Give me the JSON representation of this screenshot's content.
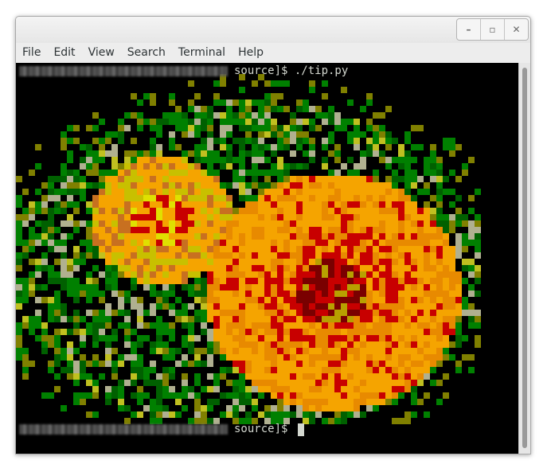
{
  "window": {
    "controls": {
      "minimize_icon": "minimize-icon",
      "maximize_icon": "maximize-icon",
      "close_icon": "close-icon",
      "minimize_glyph": "–",
      "maximize_glyph": "▫",
      "close_glyph": "✕"
    }
  },
  "menubar": {
    "items": [
      {
        "label": "File"
      },
      {
        "label": "Edit"
      },
      {
        "label": "View"
      },
      {
        "label": "Search"
      },
      {
        "label": "Terminal"
      },
      {
        "label": "Help"
      }
    ]
  },
  "terminal": {
    "lines": [
      {
        "prompt_tail": "source]$ ",
        "command": "./tip.py"
      },
      {
        "prompt_tail": "source]$ ",
        "command": ""
      }
    ],
    "colors": {
      "background": "#000000",
      "text": "#d3d7cf"
    },
    "palette": [
      "#000000",
      "#f5a400",
      "#e88a00",
      "#c80000",
      "#7a0000",
      "#008000",
      "#006000",
      "#808000",
      "#c0c020",
      "#b0b090",
      "#e0e000",
      "#c87020"
    ]
  }
}
